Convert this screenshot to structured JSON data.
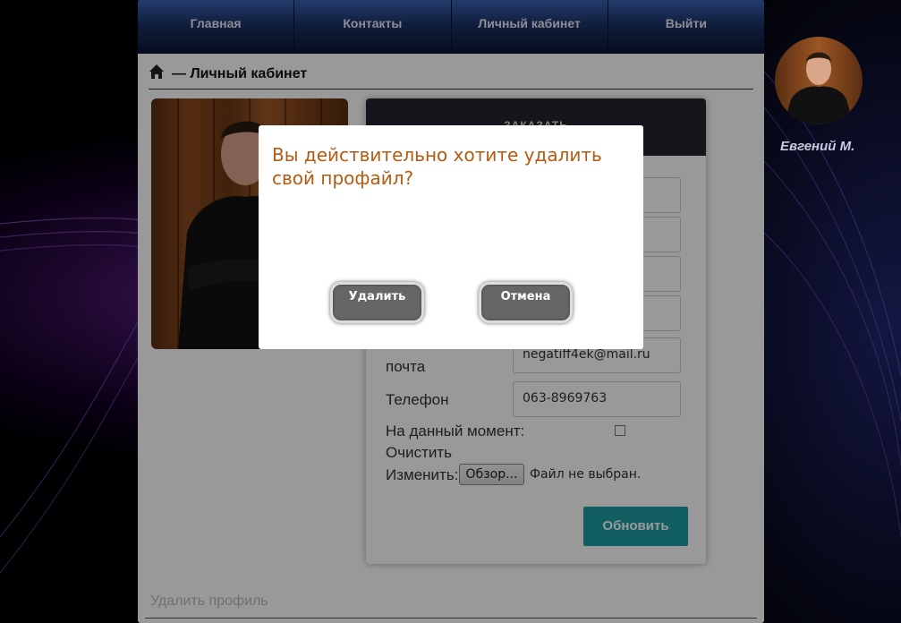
{
  "nav": {
    "items": [
      "Главная",
      "Контакты",
      "Личный кабинет",
      "Выйти"
    ]
  },
  "breadcrumb": {
    "icon": "home-icon",
    "text": "— Личный кабинет"
  },
  "profile_form": {
    "header": "ЗАКАЗАТЬ",
    "email_label": "почта",
    "email_value": "negatiff4ek@mail.ru",
    "phone_label": "Телефон",
    "phone_value": "063-8969763",
    "current_label": "На данный момент:",
    "clear_label": "Очистить",
    "change_label": "Изменить:",
    "file_button": "Обзор...",
    "file_status": "Файл не выбран.",
    "update_button": "Обновить"
  },
  "delete_profile_link": "Удалить профиль",
  "user": {
    "name": "Евгений М."
  },
  "modal": {
    "question": "Вы действительно хотите удалить свой профайл?",
    "confirm_button": "Удалить",
    "cancel_button": "Отмена"
  },
  "colors": {
    "accent_teal": "#1f9ea3",
    "modal_text": "#b55a10",
    "nav_top": "#3a64b4"
  }
}
